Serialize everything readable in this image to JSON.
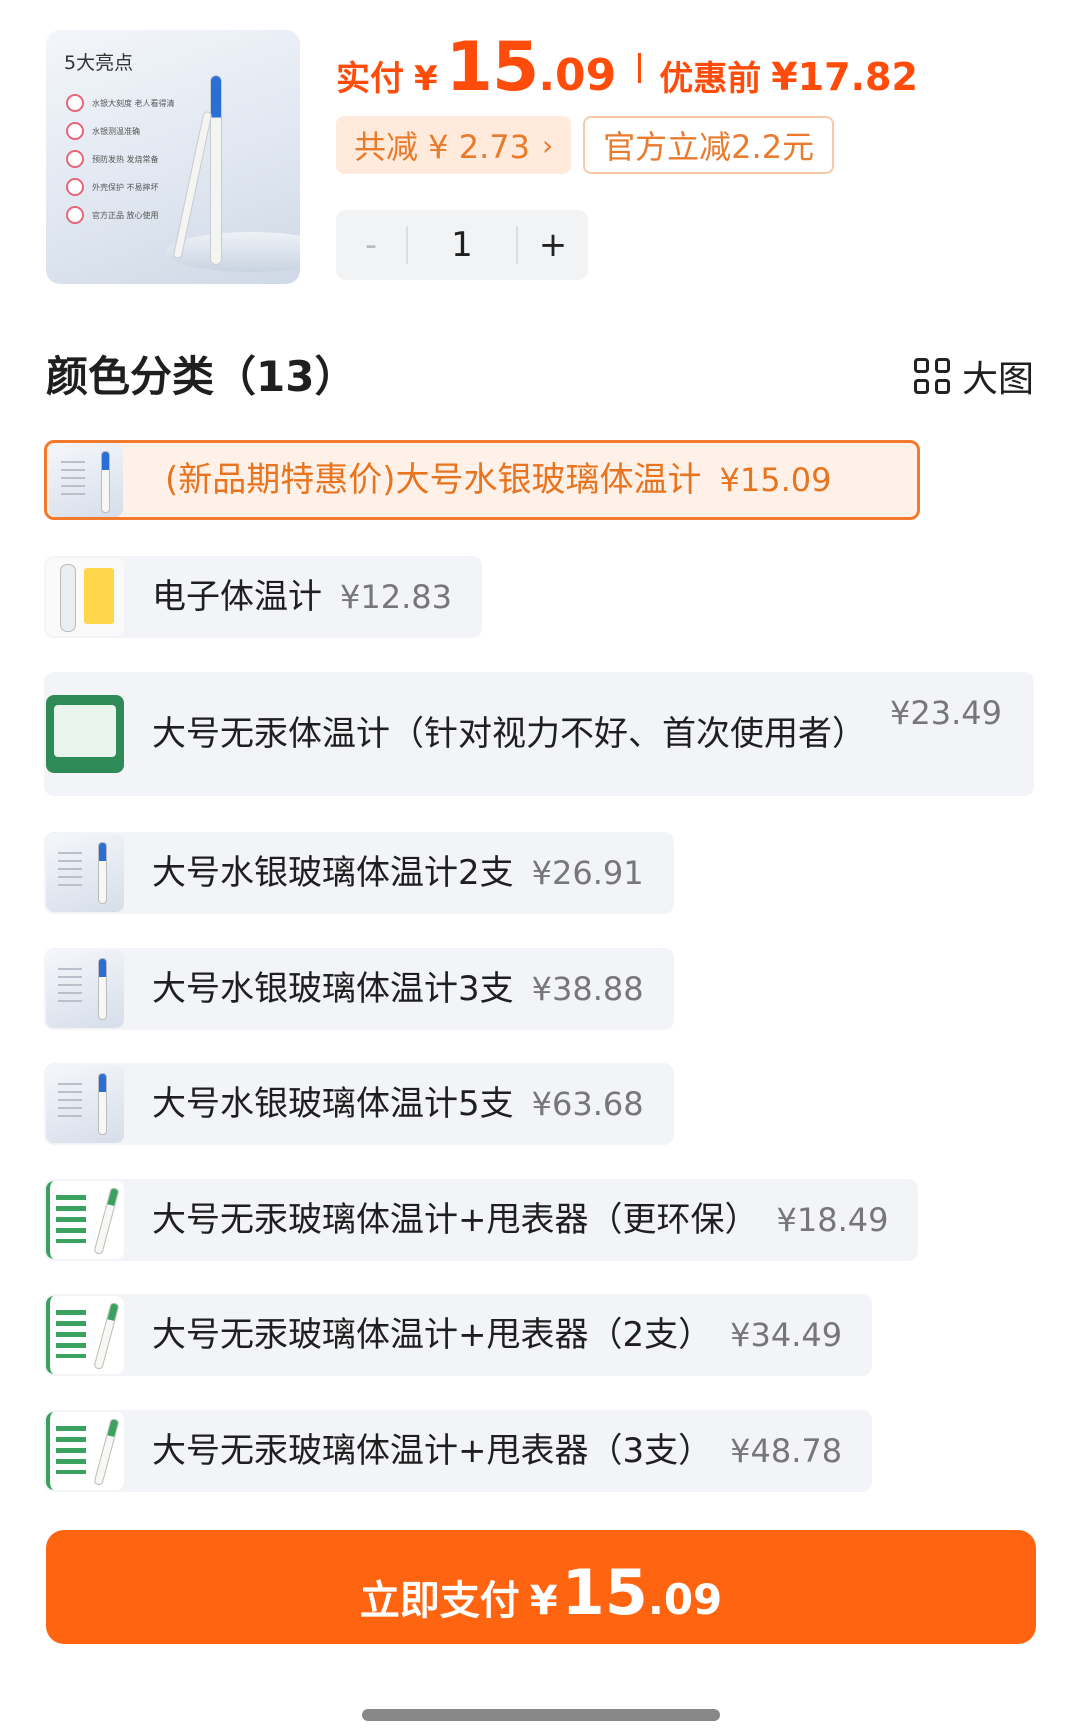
{
  "product": {
    "image_title": "5大亮点",
    "image_features": [
      "水银大刻度 老人看得清",
      "水银测温准确",
      "预防发热 发烧常备",
      "外壳保护 不易摔坏",
      "官方正品 放心使用"
    ]
  },
  "price": {
    "paid_label": "实付",
    "currency": "¥",
    "paid_integer": "15",
    "paid_decimal": ".09",
    "before_label": "优惠前",
    "before_price": "¥17.82"
  },
  "discounts": {
    "total_saved": "共减 ¥ 2.73",
    "official_cut": "官方立减2.2元"
  },
  "quantity": {
    "minus": "-",
    "value": "1",
    "plus": "+"
  },
  "variants": {
    "title": "颜色分类（13）",
    "view_label": "大图",
    "items": [
      {
        "name": "(新品期特惠价)大号水银玻璃体温计",
        "price": "¥15.09"
      },
      {
        "name": "电子体温计",
        "price": "¥12.83"
      },
      {
        "name": "大号无汞体温计（针对视力不好、首次使用者）",
        "price": "¥23.49"
      },
      {
        "name": "大号水银玻璃体温计2支",
        "price": "¥26.91"
      },
      {
        "name": "大号水银玻璃体温计3支",
        "price": "¥38.88"
      },
      {
        "name": "大号水银玻璃体温计5支",
        "price": "¥63.68"
      },
      {
        "name": "大号无汞玻璃体温计+甩表器（更环保）",
        "price": "¥18.49"
      },
      {
        "name": "大号无汞玻璃体温计+甩表器（2支）",
        "price": "¥34.49"
      },
      {
        "name": "大号无汞玻璃体温计+甩表器（3支）",
        "price": "¥48.78"
      }
    ],
    "selected_index": 0
  },
  "pay_button": {
    "label": "立即支付",
    "currency": "¥",
    "integer": "15",
    "decimal": ".09"
  },
  "colors": {
    "accent": "#ff6410",
    "price_red": "#ff4c0a",
    "selected_border": "#f27a2c"
  }
}
